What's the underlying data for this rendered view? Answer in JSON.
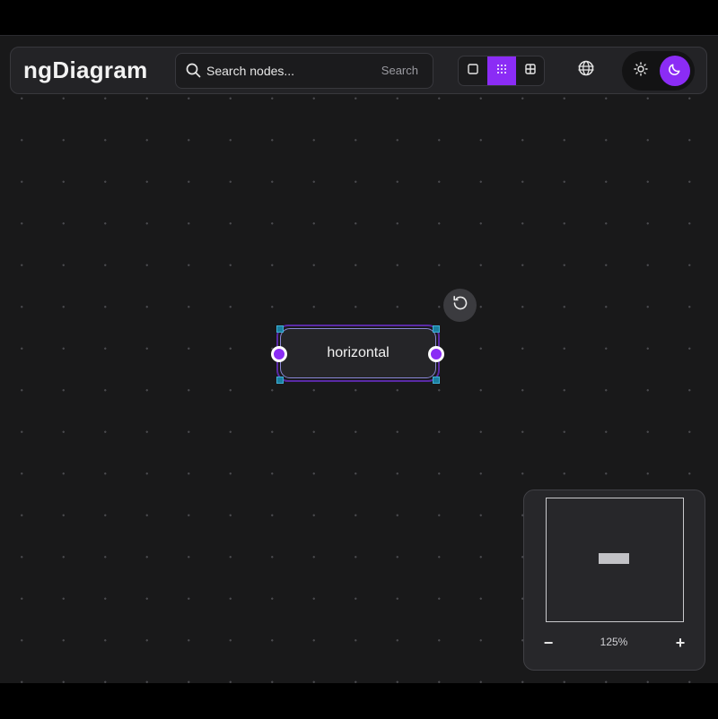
{
  "app": {
    "title": "ngDiagram"
  },
  "search": {
    "placeholder": "Search nodes...",
    "button_label": "Search"
  },
  "background_toggle": {
    "options": [
      "plain-background-icon",
      "dots-background-icon",
      "grid-background-icon"
    ],
    "selected": "dots"
  },
  "theme_toggle": {
    "options": [
      "sun-icon",
      "moon-icon"
    ],
    "selected": "dark"
  },
  "node": {
    "label": "horizontal"
  },
  "minimap": {
    "zoom_out_label": "−",
    "zoom_label": "125%",
    "zoom_in_label": "+"
  },
  "colors": {
    "accent": "#8b2cf5",
    "canvas": "#19191a",
    "panel": "#232326",
    "node_border": "#8a87d6",
    "resize_handle": "#1a7fa0"
  }
}
